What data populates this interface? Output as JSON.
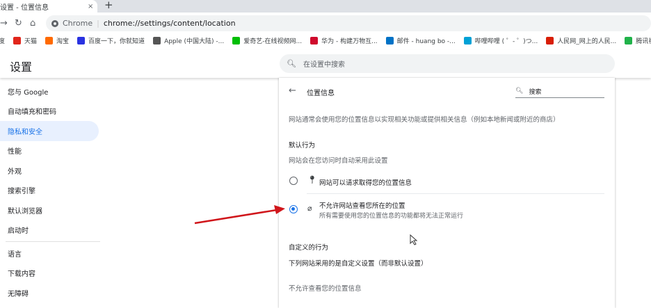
{
  "browser": {
    "tab_title": "设置 - 位置信息",
    "tab_close": "×",
    "new_tab": "+",
    "omnibox_chip": "Chrome",
    "omnibox_sep": "|",
    "url": "chrome://settings/content/location",
    "bookmarks": [
      {
        "label": "度",
        "color": "#2932e1"
      },
      {
        "label": "天猫",
        "color": "#e1251b"
      },
      {
        "label": "淘宝",
        "color": "#ff6a00"
      },
      {
        "label": "百度一下，你就知道",
        "color": "#2932e1"
      },
      {
        "label": "Apple (中国大陆) -...",
        "color": "#555555"
      },
      {
        "label": "爱奇艺-在线视频网...",
        "color": "#00be06"
      },
      {
        "label": "华为 - 构建万物互...",
        "color": "#cf0a2c"
      },
      {
        "label": "邮件 - huang bo -...",
        "color": "#0072c6"
      },
      {
        "label": "哔哩哔哩 ( ゜- ゜)つ...",
        "color": "#00a1d6"
      },
      {
        "label": "人民网_网上的人民...",
        "color": "#d81e06"
      },
      {
        "label": "腾讯视频-中国领",
        "color": "#20b24a"
      }
    ]
  },
  "header": {
    "title": "设置",
    "search_placeholder": "在设置中搜索"
  },
  "sidebar": {
    "items": [
      {
        "label": "您与 Google"
      },
      {
        "label": "自动填充和密码"
      },
      {
        "label": "隐私和安全",
        "active": true
      },
      {
        "label": "性能"
      },
      {
        "label": "外观"
      },
      {
        "label": "搜索引擎"
      },
      {
        "label": "默认浏览器"
      },
      {
        "label": "启动时"
      },
      {
        "label": "语言"
      },
      {
        "label": "下载内容"
      },
      {
        "label": "无障碍"
      }
    ]
  },
  "page": {
    "title": "位置信息",
    "search_placeholder": "搜索",
    "description": "网站通常会使用您的位置信息以实现相关功能或提供相关信息（例如本地新闻或附近的商店）",
    "default_heading": "默认行为",
    "default_sub": "网站会在您访问时自动采用此设置",
    "options": [
      {
        "label": "网站可以请求取得您的位置信息",
        "selected": false
      },
      {
        "label": "不允许网站查看您所在的位置",
        "sub": "所有需要使用您的位置信息的功能都将无法正常运行",
        "selected": true
      }
    ],
    "custom_heading": "自定义的行为",
    "custom_sub": "下列网站采用的是自定义设置（而非默认设置）",
    "blocked_heading": "不允许查看您的位置信息"
  },
  "colors": {
    "accent": "#1a73e8",
    "annotation_arrow": "#d0161b"
  }
}
